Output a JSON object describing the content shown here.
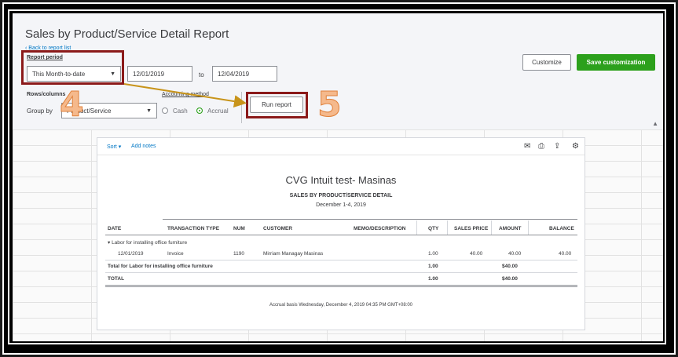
{
  "header": {
    "title": "Sales by Product/Service Detail Report",
    "back_link": "‹ Back to report list",
    "report_period_label": "Report period",
    "period_value": "This Month-to-date",
    "from_date": "12/01/2019",
    "to_label": "to",
    "to_date": "12/04/2019",
    "rows_columns_label": "Rows/columns",
    "group_by_label": "Group by",
    "group_by_value": "Product/Service",
    "accounting_method_label": "Accounting method",
    "cash_label": "Cash",
    "accrual_label": "Accrual",
    "run_report_label": "Run report",
    "customize_label": "Customize",
    "save_customization_label": "Save customization"
  },
  "annotations": {
    "step4": "4",
    "step5": "5"
  },
  "report": {
    "toolbar": {
      "sort_label": "Sort ▾",
      "add_notes_label": "Add notes"
    },
    "company": "CVG Intuit test- Masinas",
    "title": "SALES BY PRODUCT/SERVICE DETAIL",
    "date_range": "December 1-4, 2019",
    "columns": [
      "DATE",
      "TRANSACTION TYPE",
      "NUM",
      "CUSTOMER",
      "MEMO/DESCRIPTION",
      "QTY",
      "SALES PRICE",
      "AMOUNT",
      "BALANCE"
    ],
    "group_label": "▾ Labor for installing office furniture",
    "row": {
      "date": "12/01/2019",
      "type": "Invoice",
      "num": "1190",
      "customer": "Mirriam Managay Masinas",
      "memo": "",
      "qty": "1.00",
      "price": "40.00",
      "amount": "40.00",
      "balance": "40.00"
    },
    "group_total": {
      "label": "Total for Labor for installing office furniture",
      "qty": "1.00",
      "amount": "$40.00"
    },
    "total": {
      "label": "TOTAL",
      "qty": "1.00",
      "amount": "$40.00"
    },
    "footer": "Accrual basis  Wednesday, December 4, 2019  04:35 PM GMT+08:00"
  },
  "colors": {
    "accent_green": "#2ca01c",
    "link_blue": "#0077c5",
    "annotation_red": "#8b1a1a",
    "annotation_arrow": "#c8941a",
    "annotation_number": "#f5b98c"
  }
}
